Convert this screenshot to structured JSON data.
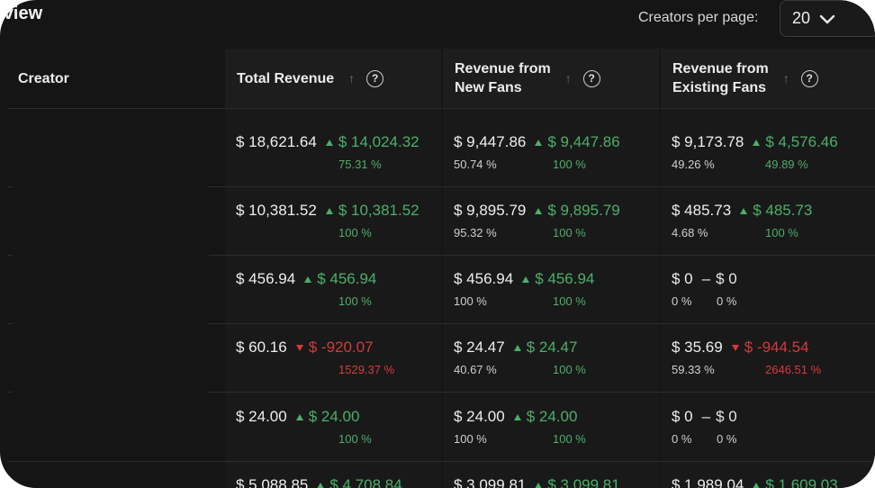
{
  "header": {
    "title": "rview",
    "per_page_label": "Creators per page:",
    "per_page_value": "20"
  },
  "columns": {
    "creator": "Creator",
    "total_revenue": "Total Revenue",
    "new_fans": "Revenue from\nNew Fans",
    "existing_fans": "Revenue from\nExisting Fans",
    "sort_icon": "↑",
    "help_icon": "?"
  },
  "rows": [
    {
      "total": {
        "value": "$ 18,621.64",
        "delta": "$ 14,024.32",
        "pct": "75.31 %",
        "trend": "up"
      },
      "new": {
        "value": "$ 9,447.86",
        "delta": "$ 9,447.86",
        "share": "50.74 %",
        "pct": "100 %",
        "trend": "up"
      },
      "existing": {
        "value": "$ 9,173.78",
        "delta": "$ 4,576.46",
        "share": "49.26 %",
        "pct": "49.89 %",
        "trend": "up"
      }
    },
    {
      "total": {
        "value": "$ 10,381.52",
        "delta": "$ 10,381.52",
        "pct": "100 %",
        "trend": "up"
      },
      "new": {
        "value": "$ 9,895.79",
        "delta": "$ 9,895.79",
        "share": "95.32 %",
        "pct": "100 %",
        "trend": "up"
      },
      "existing": {
        "value": "$ 485.73",
        "delta": "$ 485.73",
        "share": "4.68 %",
        "pct": "100 %",
        "trend": "up"
      }
    },
    {
      "total": {
        "value": "$ 456.94",
        "delta": "$ 456.94",
        "pct": "100 %",
        "trend": "up"
      },
      "new": {
        "value": "$ 456.94",
        "delta": "$ 456.94",
        "share": "100 %",
        "pct": "100 %",
        "trend": "up"
      },
      "existing": {
        "value": "$ 0",
        "delta": "$ 0",
        "share": "0 %",
        "pct": "0 %",
        "trend": "flat"
      }
    },
    {
      "total": {
        "value": "$ 60.16",
        "delta": "$ -920.07",
        "pct": "1529.37 %",
        "trend": "down"
      },
      "new": {
        "value": "$ 24.47",
        "delta": "$ 24.47",
        "share": "40.67 %",
        "pct": "100 %",
        "trend": "up"
      },
      "existing": {
        "value": "$ 35.69",
        "delta": "$ -944.54",
        "share": "59.33 %",
        "pct": "2646.51 %",
        "trend": "down"
      }
    },
    {
      "total": {
        "value": "$ 24.00",
        "delta": "$ 24.00",
        "pct": "100 %",
        "trend": "up"
      },
      "new": {
        "value": "$ 24.00",
        "delta": "$ 24.00",
        "share": "100 %",
        "pct": "100 %",
        "trend": "up"
      },
      "existing": {
        "value": "$ 0",
        "delta": "$ 0",
        "share": "0 %",
        "pct": "0 %",
        "trend": "flat"
      }
    },
    {
      "total": {
        "value": "$ 5,088.85",
        "delta": "$ 4,708.84",
        "pct": "",
        "trend": "up"
      },
      "new": {
        "value": "$ 3,099.81",
        "delta": "$ 3,099.81",
        "share": "",
        "pct": "",
        "trend": "up"
      },
      "existing": {
        "value": "$ 1,989.04",
        "delta": "$ 1,609.03",
        "share": "",
        "pct": "",
        "trend": "up"
      }
    }
  ]
}
